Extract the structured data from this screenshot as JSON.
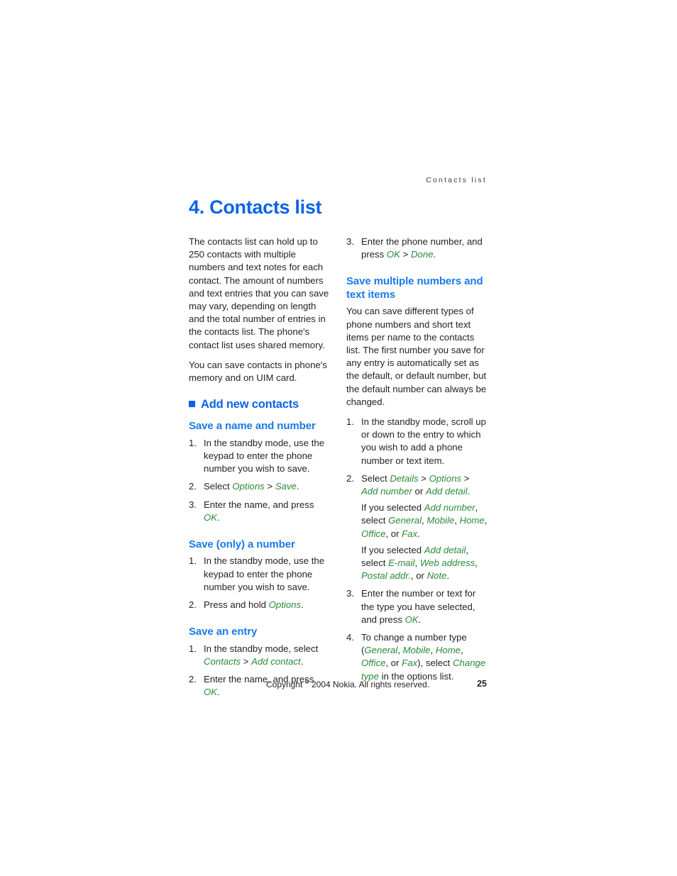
{
  "header": {
    "running_title": "Contacts list"
  },
  "title": "4. Contacts list",
  "left_column": {
    "intro_paragraph_1": "The contacts list can hold up to 250 contacts with multiple numbers and text notes for each contact. The amount of numbers and text entries that you can save may vary, depending on length and the total number of entries in the contacts list. The phone's contact list uses shared memory.",
    "intro_paragraph_2": "You can save contacts in phone's memory and on UIM card.",
    "section_heading": "Add new contacts",
    "sub1": {
      "heading": "Save a name and number",
      "step1_num": "1.",
      "step1_text": "In the standby mode, use the keypad to enter the phone number you wish to save.",
      "step2_num": "2.",
      "step2_pre": "Select ",
      "step2_ui1": "Options",
      "step2_mid": " > ",
      "step2_ui2": "Save",
      "step2_post": ".",
      "step3_num": "3.",
      "step3_pre": "Enter the name, and press ",
      "step3_ui1": "OK",
      "step3_post": "."
    },
    "sub2": {
      "heading": "Save (only) a number",
      "step1_num": "1.",
      "step1_text": "In the standby mode, use the keypad to enter the phone number you wish to save.",
      "step2_num": "2.",
      "step2_pre": "Press and hold ",
      "step2_ui1": "Options",
      "step2_post": "."
    },
    "sub3": {
      "heading": "Save an entry",
      "step1_num": "1.",
      "step1_pre": "In the standby mode, select ",
      "step1_ui1": "Contacts",
      "step1_mid": " > ",
      "step1_ui2": "Add contact",
      "step1_post": ".",
      "step2_num": "2.",
      "step2_pre": "Enter the name, and press ",
      "step2_ui1": "OK",
      "step2_post": "."
    }
  },
  "right_column": {
    "step3_num": "3.",
    "step3_pre": "Enter the phone number, and press ",
    "step3_ui1": "OK",
    "step3_mid": " > ",
    "step3_ui2": "Done",
    "step3_post": ".",
    "sub_heading": "Save multiple numbers and text items",
    "paragraph": "You can save different types of phone numbers and short text items per name to the contacts list. The first number you save for any entry is automatically set as the default, or default number, but the default number can always be changed.",
    "step1_num": "1.",
    "step1_text": "In the standby mode, scroll up or down to the entry to which you wish to add a phone number or text item.",
    "step2_num": "2.",
    "step2_pre": "Select ",
    "step2_ui1": "Details",
    "step2_gt1": " > ",
    "step2_ui2": "Options",
    "step2_gt2": " > ",
    "step2_ui3": "Add number",
    "step2_or": " or ",
    "step2_ui4": "Add detail",
    "step2_post": ".",
    "step2_sub1_pre": "If you selected ",
    "step2_sub1_ui1": "Add number",
    "step2_sub1_mid": ", select ",
    "step2_sub1_ui2": "General",
    "step2_sub1_c1": ", ",
    "step2_sub1_ui3": "Mobile",
    "step2_sub1_c2": ", ",
    "step2_sub1_ui4": "Home",
    "step2_sub1_c3": ", ",
    "step2_sub1_ui5": "Office",
    "step2_sub1_c4": ", or ",
    "step2_sub1_ui6": "Fax",
    "step2_sub1_post": ".",
    "step2_sub2_pre": "If you selected ",
    "step2_sub2_ui1": "Add detail",
    "step2_sub2_mid": ", select ",
    "step2_sub2_ui2": "E-mail",
    "step2_sub2_c1": ", ",
    "step2_sub2_ui3": "Web address",
    "step2_sub2_c2": ", ",
    "step2_sub2_ui4": "Postal addr.",
    "step2_sub2_c3": ", or ",
    "step2_sub2_ui5": "Note",
    "step2_sub2_post": ".",
    "step3b_num": "3.",
    "step3b_pre": "Enter the number or text for the type you have selected, and press ",
    "step3b_ui1": "OK",
    "step3b_post": ".",
    "step4_num": "4.",
    "step4_pre": "To change a number type (",
    "step4_ui1": "General",
    "step4_c1": ", ",
    "step4_ui2": "Mobile",
    "step4_c2": ", ",
    "step4_ui3": "Home",
    "step4_c3": ", ",
    "step4_ui4": "Office",
    "step4_c4": ", or ",
    "step4_ui5": "Fax",
    "step4_c5": "), select ",
    "step4_ui6": "Change type",
    "step4_post": " in the options list."
  },
  "footer": {
    "copyright_pre": "Copyright ",
    "copyright_symbol": "©",
    "copyright_post": " 2004 Nokia. All rights reserved.",
    "page_number": "25"
  },
  "colors": {
    "title_blue": "#0a63e8",
    "subheading_blue": "#1a7ae8",
    "ui_green": "#2a8a37",
    "body_black": "#231f20"
  }
}
